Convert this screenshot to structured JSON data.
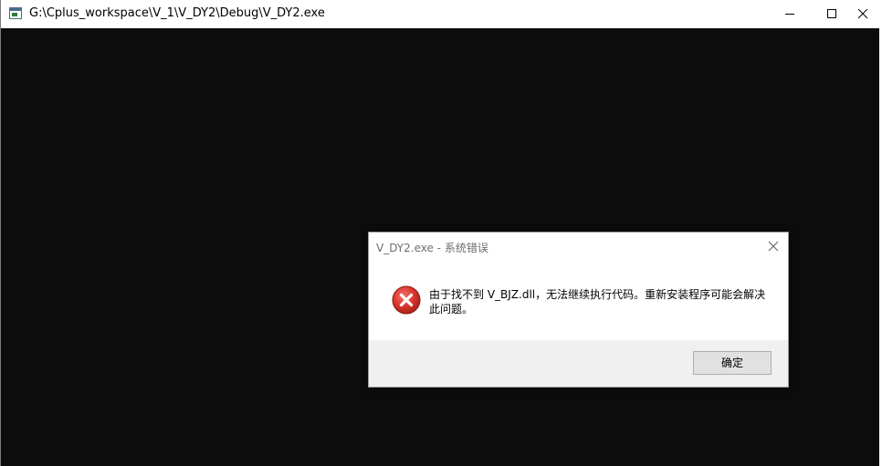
{
  "window": {
    "title": "G:\\Cplus_workspace\\V_1\\V_DY2\\Debug\\V_DY2.exe",
    "icon": "console-app-icon",
    "controls": [
      "minimize-icon",
      "maximize-icon",
      "close-icon"
    ]
  },
  "dialog": {
    "title": "V_DY2.exe - 系统错误",
    "icon": "error-icon",
    "message": "由于找不到 V_BJZ.dll，无法继续执行代码。重新安装程序可能会解决此问题。",
    "ok_label": "确定"
  },
  "colors": {
    "console_bg": "#0c0c0c",
    "dialog_footer": "#f0f0f0",
    "error_red": "#d6332a"
  }
}
